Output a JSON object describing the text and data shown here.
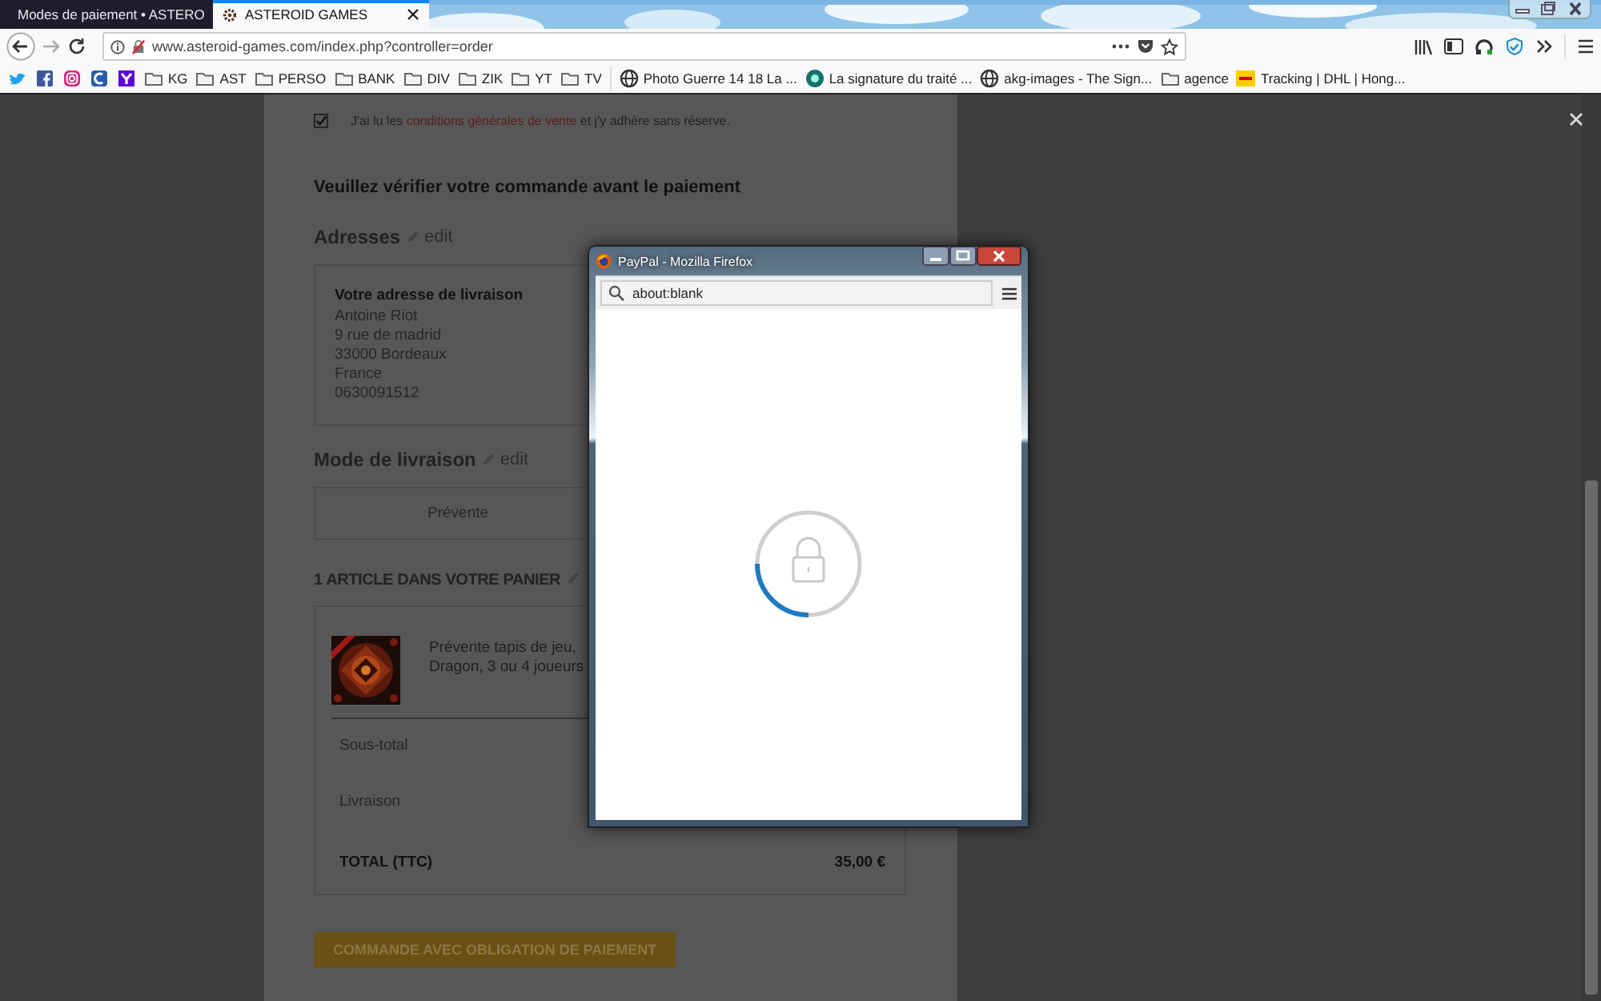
{
  "browser": {
    "tabs": [
      {
        "title": "Modes de paiement • ASTERO",
        "selected": false
      },
      {
        "title": "ASTEROID GAMES",
        "selected": true
      }
    ],
    "url": "www.asteroid-games.com/index.php?controller=order",
    "bookmarks": [
      {
        "kind": "bird"
      },
      {
        "kind": "fb"
      },
      {
        "kind": "insta"
      },
      {
        "kind": "ring"
      },
      {
        "kind": "purple"
      },
      {
        "kind": "folder",
        "label": "KG"
      },
      {
        "kind": "folder",
        "label": "AST"
      },
      {
        "kind": "folder",
        "label": "PERSO"
      },
      {
        "kind": "folder",
        "label": "BANK"
      },
      {
        "kind": "folder",
        "label": "DIV"
      },
      {
        "kind": "folder",
        "label": "ZIK"
      },
      {
        "kind": "folder",
        "label": "YT"
      },
      {
        "kind": "folder",
        "label": "TV"
      },
      {
        "kind": "separator"
      },
      {
        "kind": "globe",
        "label": "Photo Guerre 14 18 La ..."
      },
      {
        "kind": "badge",
        "label": "La signature du traité ..."
      },
      {
        "kind": "globe",
        "label": "akg-images - The Sign..."
      },
      {
        "kind": "folder",
        "label": "agence"
      },
      {
        "kind": "dhl",
        "label": "Tracking | DHL | Hong..."
      }
    ]
  },
  "page": {
    "terms": {
      "checked": true,
      "before": "J'ai lu les",
      "link": "conditions générales de vente",
      "after": "et j'y adhère sans réserve."
    },
    "heading": "Veuillez vérifier votre commande avant le paiement",
    "addresses": {
      "title": "Adresses",
      "edit": "edit",
      "card_title": "Votre adresse de livraison",
      "lines": [
        "Antoine Riot",
        "9 rue de madrid",
        "33000 Bordeaux",
        "France",
        "0630091512"
      ]
    },
    "delivery": {
      "title": "Mode de livraison",
      "edit": "edit",
      "option": "Prévente"
    },
    "cart": {
      "title": "1 ARTICLE DANS VOTRE PANIER",
      "item": {
        "kind": "picture",
        "name": "Prévente tapis de jeu, Dragon, 3 ou 4 joueurs"
      },
      "rows": [
        {
          "label": "Sous-total"
        },
        {
          "label": "Livraison"
        },
        {
          "label": "TOTAL (TTC)",
          "value": "35,00 €",
          "bold": true
        }
      ]
    },
    "button": {
      "label": "COMMANDE AVEC OBLIGATION DE PAIEMENT",
      "disabled": true
    }
  },
  "popup": {
    "title": "PayPal - Mozilla Firefox",
    "url": "about:blank"
  }
}
